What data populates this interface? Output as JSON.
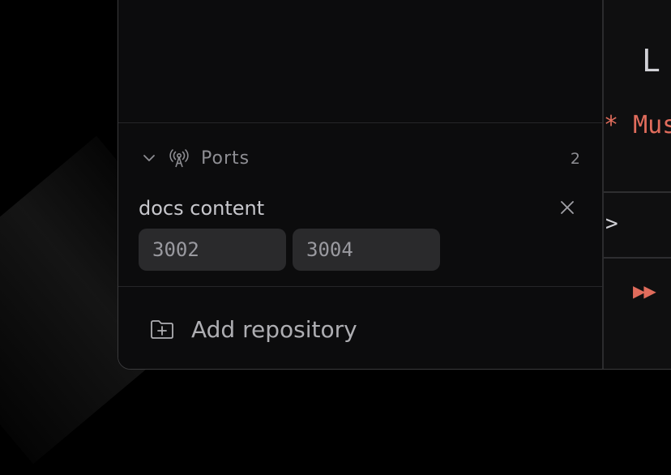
{
  "ports": {
    "label": "Ports",
    "count": "2"
  },
  "repository": {
    "name": "docs content",
    "ports": [
      "3002",
      "3004"
    ]
  },
  "actions": {
    "add_repository": "Add repository"
  },
  "terminal": {
    "line1": "L",
    "line2": "* Mus",
    "prompt": ">",
    "fast_forward": "▶▶"
  },
  "colors": {
    "accent_red": "#e06c5c",
    "chip_bg": "#2a2a2c",
    "muted_text": "#8e8e93"
  }
}
